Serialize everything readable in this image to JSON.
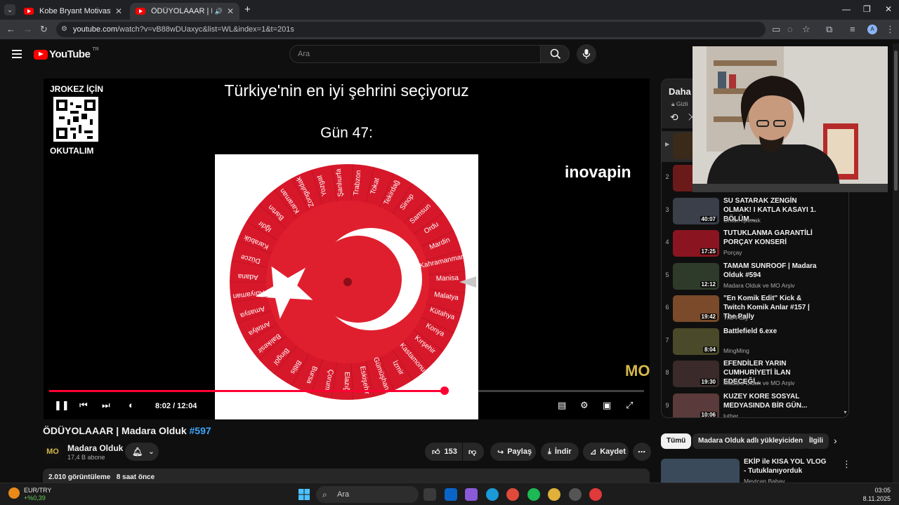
{
  "browser": {
    "tabs": [
      {
        "title": "Kobe Bryant Motivasyonu ve M",
        "active": false
      },
      {
        "title": "ÖDÜYOLAAAR | Madara Ol",
        "active": true
      }
    ],
    "url_site": "youtube.com",
    "url_path": "/watch?v=vB88wDUaxyc&list=WL&index=1&t=201s"
  },
  "youtube": {
    "logo_text": "YouTube",
    "country_code": "TR",
    "search_placeholder": "Ara"
  },
  "player": {
    "overlay_qr_top": "JROKEZ İÇİN",
    "overlay_qr_bottom": "OKUTALIM",
    "overlay_title": "Türkiye'nin en iyi şehrini seçiyoruz",
    "overlay_day": "Gün 47:",
    "sponsor_logo": "inovapin",
    "watermark": "MO",
    "time_text": "8:02 / 12:04",
    "progress_fraction": 0.665,
    "buffer_fraction": 0.72,
    "wheel_cities": [
      "Manisa",
      "Malatya",
      "Kütahya",
      "Konya",
      "Kırşehir",
      "Kastamonu",
      "İzmir",
      "Gümüşhane",
      "Eskişehir",
      "Elazığ",
      "Çorum",
      "Bursa",
      "Bitlis",
      "Bingöl",
      "Balıkesir",
      "Antalya",
      "Amasya",
      "Adıyaman",
      "Adana",
      "Düzce",
      "Karabük",
      "Iğdır",
      "Bartın",
      "Karaman",
      "Zonguldak",
      "Yozgat",
      "Şanlıurfa",
      "Trabzon",
      "Tokat",
      "Tekirdağ",
      "Sinop",
      "Samsun",
      "Ordu",
      "Mardin",
      "Kahramanmaraş"
    ]
  },
  "video": {
    "title": "ÖDÜYOLAAAR | Madara Olduk",
    "hashtag": "#597",
    "channel_name": "Madara Olduk",
    "channel_subs": "17,4 B abone",
    "likes": "153",
    "share_label": "Paylaş",
    "download_label": "İndir",
    "save_label": "Kaydet",
    "views": "2.010 görüntüleme",
    "posted": "8 saat önce"
  },
  "playlist": {
    "title": "Daha s",
    "privacy": "Gizli",
    "items": [
      {
        "index": "2",
        "title": "",
        "channel": "",
        "duration": "",
        "thumb_color": "#6b1a1a"
      },
      {
        "index": "3",
        "title": "SU SATARAK ZENGİN OLMAK! I KATLA KASAYI 1. BÖLÜM...",
        "channel": "Orkun Işıtmak",
        "duration": "40:07",
        "thumb_color": "#3a3f4a"
      },
      {
        "index": "4",
        "title": "TUTUKLANMA GARANTİLİ PORÇAY KONSERİ",
        "channel": "Porçay",
        "duration": "17:25",
        "thumb_color": "#8a1520"
      },
      {
        "index": "5",
        "title": "TAMAM SUNROOF | Madara Olduk #594",
        "channel": "Madara Olduk ve MO Arşiv",
        "duration": "12:12",
        "thumb_color": "#2f3b2a"
      },
      {
        "index": "6",
        "title": "\"En Komik Edit\" Kick & Twitch Komik Anlar #157 | The Pally",
        "channel": "The Pally",
        "duration": "19:42",
        "thumb_color": "#7a4a2a"
      },
      {
        "index": "7",
        "title": "Battlefield 6.exe",
        "channel": "MingMing",
        "duration": "8:04",
        "thumb_color": "#4a4a2a"
      },
      {
        "index": "8",
        "title": "EFENDİLER YARIN CUMHURİYETİ İLAN EDECEĞİ...",
        "channel": "Madara Olduk ve MO Arşiv",
        "duration": "19:30",
        "thumb_color": "#3a2a2a"
      },
      {
        "index": "9",
        "title": "KUZEY KORE SOSYAL MEDYASINDA BİR GÜN...",
        "channel": "luther",
        "duration": "10:06",
        "thumb_color": "#5a3a3a"
      }
    ]
  },
  "chips": [
    "Tümü",
    "Madara Olduk adlı yükleyiciden",
    "İlgili"
  ],
  "recommendation": {
    "title": "EKİP ile KISA YOL VLOG - Tutuklanıyorduk",
    "channel": "Meytcan Babay"
  },
  "taskbar": {
    "ticker_pair": "EUR/TRY",
    "ticker_change": "+%0,39",
    "search_label": "Ara",
    "time": "03:05",
    "date": "8.11.2025"
  }
}
